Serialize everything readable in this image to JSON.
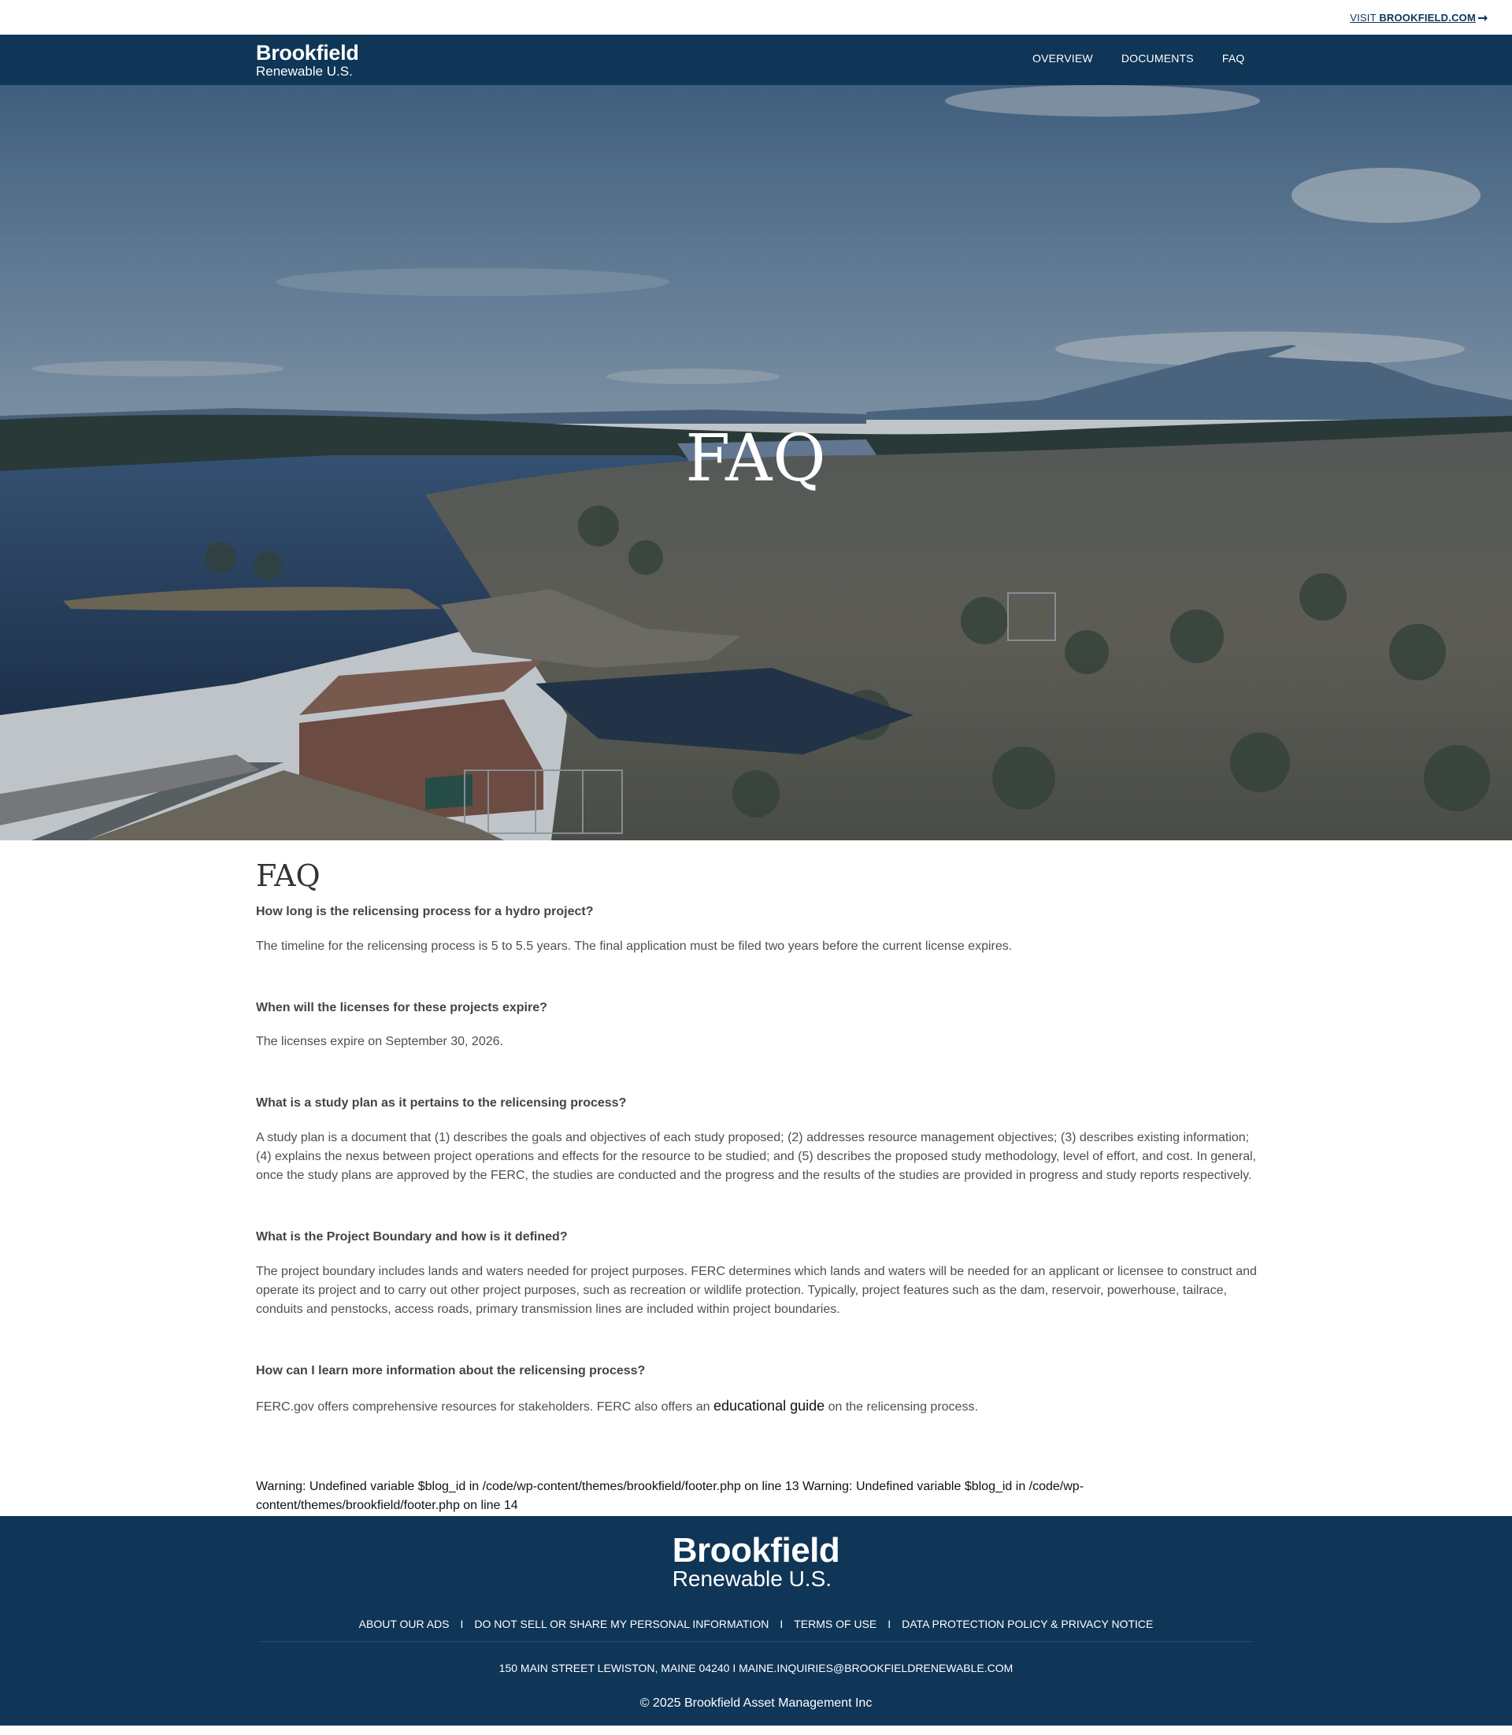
{
  "utility": {
    "visit_prefix": "VISIT ",
    "visit_strong": "BROOKFIELD.COM",
    "arrow_icon": "arrow-right-icon"
  },
  "nav": {
    "logo_line1": "Brookfield",
    "logo_line2": "Renewable U.S.",
    "items": [
      "OVERVIEW",
      "DOCUMENTS",
      "FAQ"
    ]
  },
  "hero": {
    "title": "FAQ"
  },
  "content": {
    "heading": "FAQ",
    "faqs": [
      {
        "question": "How long is the relicensing process for a hydro project?",
        "answer": "The timeline for the relicensing process is 5 to 5.5 years.  The final application must be filed two years before the current license expires."
      },
      {
        "question": "When will the licenses for these projects expire?",
        "answer": "The licenses expire on September 30, 2026."
      },
      {
        "question": "What is a study plan as it pertains to the relicensing process?",
        "answer": "A study plan is a document that (1) describes the goals and objectives of each study proposed; (2) addresses resource management objectives; (3) describes existing information; (4) explains the nexus between project operations and effects for the resource to be studied; and (5) describes the proposed study methodology, level of effort, and cost.  In general, once the study plans are approved by the FERC, the studies are conducted and the progress and the results of the studies are provided in progress and study reports respectively."
      },
      {
        "question": "What is the Project Boundary and how is it defined?",
        "answer": "The project boundary includes lands and waters needed for project purposes.  FERC determines which lands and waters will be needed for an applicant or licensee to construct and operate its project and to carry out other project purposes, such as recreation or wildlife protection.  Typically, project features such as the dam, reservoir, powerhouse, tailrace, conduits and penstocks, access roads, primary transmission lines are included within project boundaries."
      },
      {
        "question": "How can I learn more information about the relicensing process?",
        "answer_before": "FERC.gov offers comprehensive resources for stakeholders.  FERC also offers an ",
        "answer_link": "educational guide",
        "answer_after": " on the relicensing process."
      }
    ],
    "warning": "Warning: Undefined variable $blog_id in /code/wp-content/themes/brookfield/footer.php on line 13 Warning: Undefined variable $blog_id in /code/wp-content/themes/brookfield/footer.php on line 14"
  },
  "footer": {
    "logo_line1": "Brookfield",
    "logo_line2": "Renewable U.S.",
    "links": [
      "ABOUT OUR ADS",
      "DO NOT SELL OR SHARE MY PERSONAL INFORMATION",
      "TERMS OF USE",
      "DATA PROTECTION POLICY & PRIVACY NOTICE"
    ],
    "separator": "I",
    "address": "150 MAIN STREET LEWISTON, MAINE 04240 I MAINE.INQUIRIES@BROOKFIELDRENEWABLE.COM",
    "copyright": "© 2025 Brookfield Asset Management Inc"
  },
  "colors": {
    "brand_navy": "#0f3557",
    "text": "#4a4a4a",
    "white": "#ffffff"
  }
}
